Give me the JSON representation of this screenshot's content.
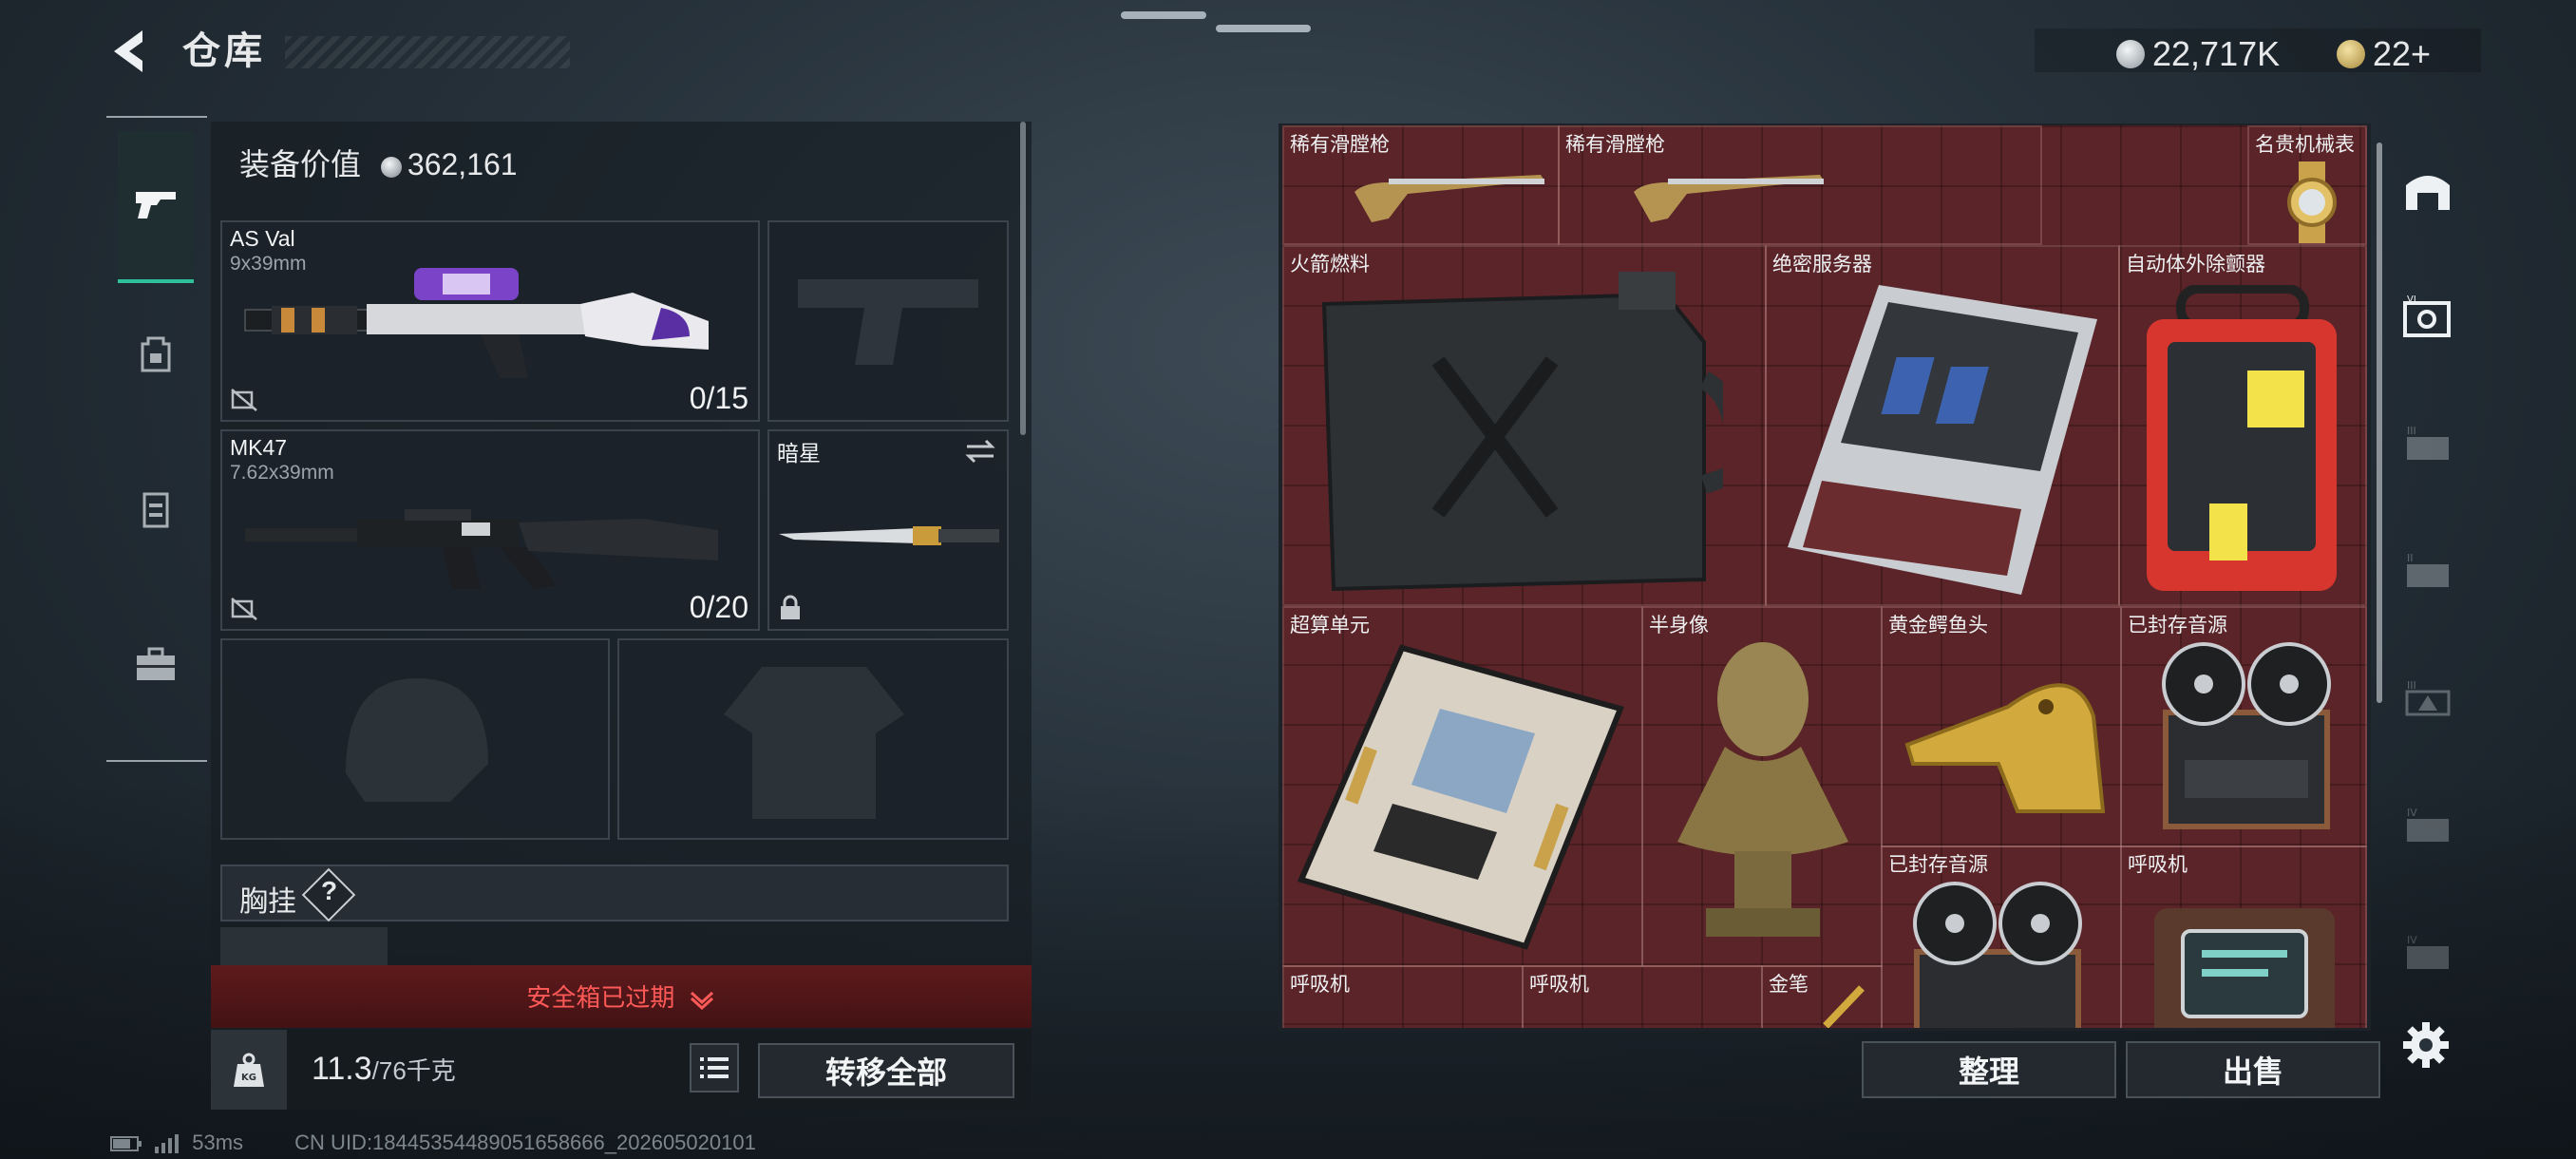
{
  "header": {
    "title": "仓库",
    "currency_main": "22,717K",
    "currency_premium": "22+"
  },
  "left_nav": {
    "items": [
      "weapons",
      "backpack",
      "armor-vest",
      "toolbox"
    ]
  },
  "equipment": {
    "value_label": "装备价值",
    "value": "362,161"
  },
  "slots": [
    {
      "name": "AS Val",
      "caliber": "9x39mm",
      "ammo": "0/15"
    },
    {
      "name": "MK47",
      "caliber": "7.62x39mm",
      "ammo": "0/20"
    },
    {
      "name": "暗星"
    }
  ],
  "chest_rig": {
    "label": "胸挂",
    "help": "?"
  },
  "safe_box": {
    "expired_text": "安全箱已过期"
  },
  "bottom": {
    "weight": "11.3",
    "capacity": "/76千克",
    "transfer_all": "转移全部",
    "sort": "整理",
    "sell": "出售"
  },
  "grid_items": [
    {
      "label": "稀有滑膛枪"
    },
    {
      "label": "稀有滑膛枪"
    },
    {
      "label": "名贵机械表"
    },
    {
      "label": "火箭燃料"
    },
    {
      "label": "绝密服务器"
    },
    {
      "label": "自动体外除颤器"
    },
    {
      "label": "超算单元"
    },
    {
      "label": "半身像"
    },
    {
      "label": "黄金鳄鱼头"
    },
    {
      "label": "已封存音源"
    },
    {
      "label": "已封存音源"
    },
    {
      "label": "呼吸机"
    },
    {
      "label": "呼吸机"
    },
    {
      "label": "呼吸机"
    },
    {
      "label": "金笔"
    }
  ],
  "status": {
    "ping": "53ms",
    "uid": "CN UID:18445354489051658666_202605020101"
  },
  "colors": {
    "grid_red": "#5a2428",
    "accent_green": "#2fbf9a",
    "warning_red": "#ff5a58"
  }
}
